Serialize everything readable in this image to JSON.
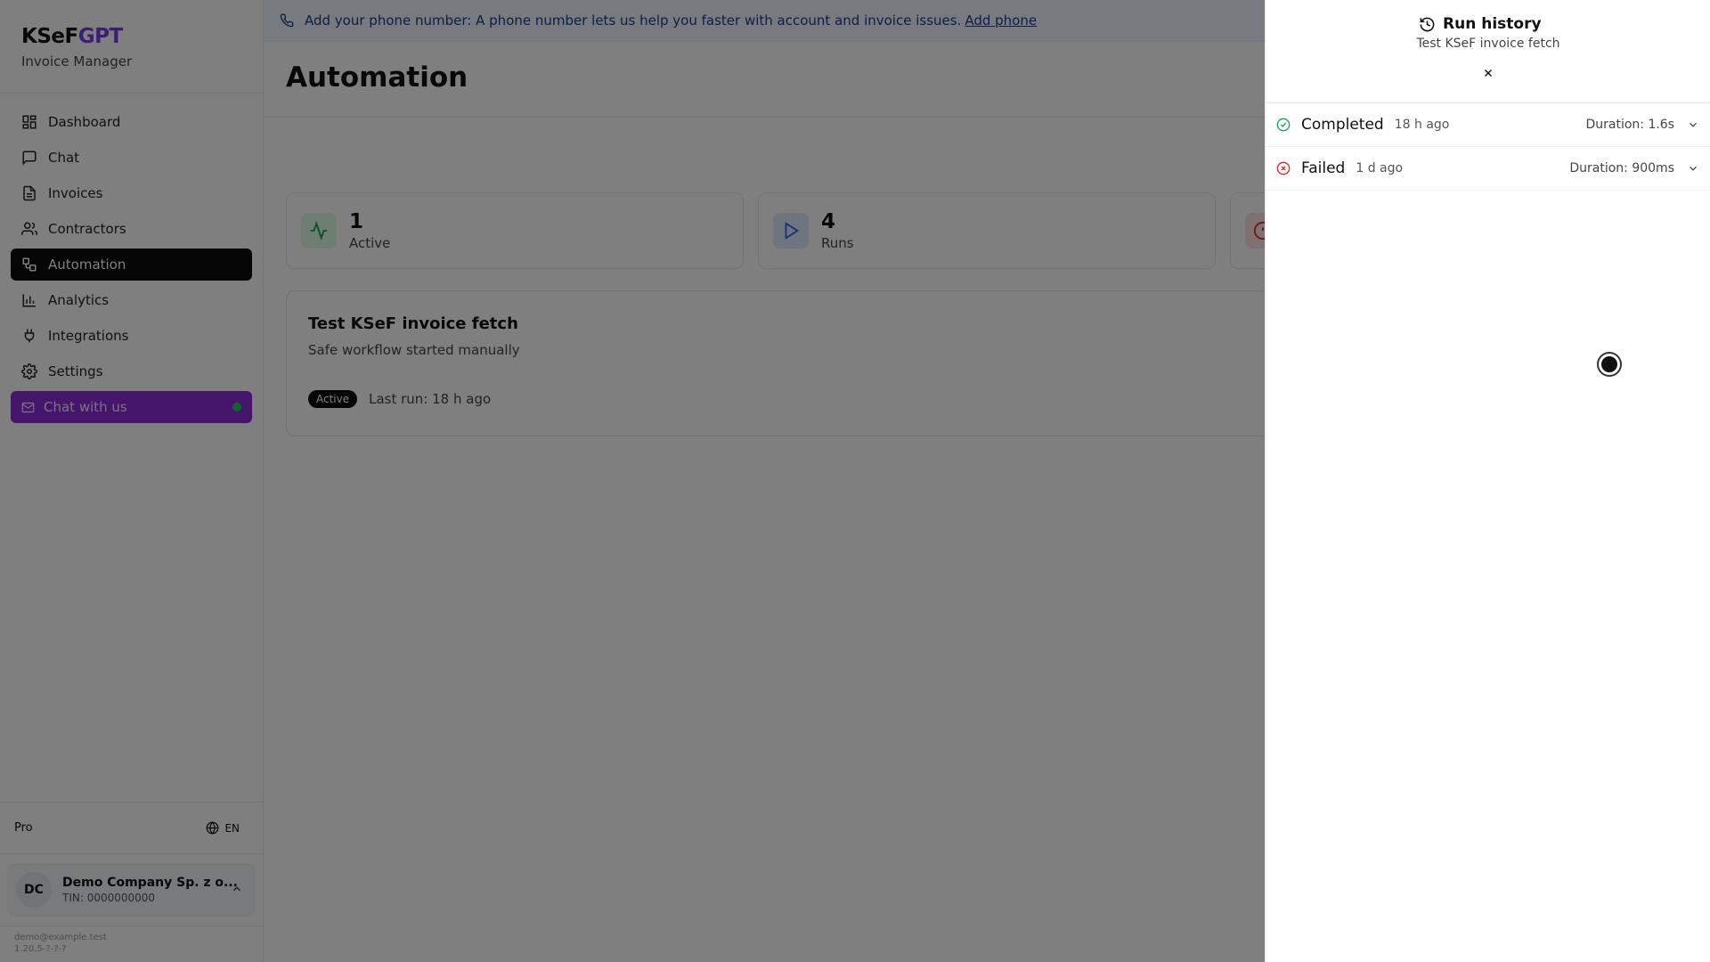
{
  "brand": {
    "name_part1": "KSeF",
    "name_part2": "GPT",
    "subtitle": "Invoice Manager"
  },
  "sidebar": {
    "items": [
      {
        "label": "Dashboard",
        "icon": "dashboard-icon"
      },
      {
        "label": "Chat",
        "icon": "chat-icon"
      },
      {
        "label": "Invoices",
        "icon": "invoice-icon"
      },
      {
        "label": "Contractors",
        "icon": "users-icon"
      },
      {
        "label": "Automation",
        "icon": "automation-icon",
        "active": true
      },
      {
        "label": "Analytics",
        "icon": "analytics-icon"
      },
      {
        "label": "Integrations",
        "icon": "plug-icon"
      },
      {
        "label": "Settings",
        "icon": "gear-icon"
      }
    ],
    "chat_with_us": "Chat with us",
    "plan": "Pro",
    "language": "EN",
    "company": {
      "initials": "DC",
      "name": "Demo Company Sp. z o...",
      "tin": "TIN: 0000000000"
    },
    "footer_email": "demo@example.test",
    "footer_version": "1.20.5-?-?-?"
  },
  "banner": {
    "text": "Add your phone number: A phone number lets us help you faster with account and invoice issues.",
    "link": "Add phone"
  },
  "page": {
    "title": "Automation"
  },
  "stats": [
    {
      "value": "1",
      "label": "Active",
      "icon": "activity-icon",
      "color": "#16a34a",
      "bg": "#dcfce7"
    },
    {
      "value": "4",
      "label": "Runs",
      "icon": "play-icon",
      "color": "#2563eb",
      "bg": "#dbeafe"
    }
  ],
  "workflow": {
    "title": "Test KSeF invoice fetch",
    "description": "Safe workflow started manually",
    "status": "Active",
    "last_run": "Last run: 18 h ago"
  },
  "panel": {
    "title": "Run history",
    "subtitle": "Test KSeF invoice fetch",
    "runs": [
      {
        "status": "Completed",
        "ago": "18 h ago",
        "duration": "Duration: 1.6s",
        "color": "#16a34a"
      },
      {
        "status": "Failed",
        "ago": "1 d ago",
        "duration": "Duration: 900ms",
        "color": "#dc2626"
      }
    ]
  }
}
